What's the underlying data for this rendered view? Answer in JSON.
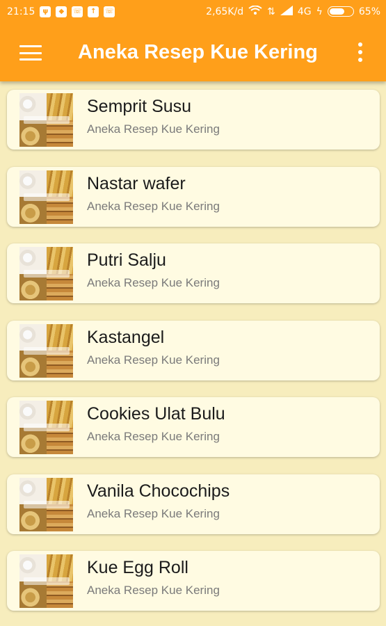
{
  "status_bar": {
    "time": "21:15",
    "notifications": [
      "usb-icon",
      "android-icon",
      "whatsapp-icon",
      "download-icon",
      "whatsapp-icon"
    ],
    "network_speed": "2,65K/d",
    "network_type": "4G",
    "battery": "65%",
    "battery_level": 0.65
  },
  "app_bar": {
    "title": "Aneka Resep Kue Kering",
    "menu_icon": "hamburger-menu-icon",
    "overflow_icon": "more-vertical-icon",
    "color": "#ff9f1a"
  },
  "recipes": [
    {
      "title": "Semprit Susu",
      "subtitle": "Aneka Resep Kue Kering"
    },
    {
      "title": "Nastar wafer",
      "subtitle": "Aneka Resep Kue Kering"
    },
    {
      "title": "Putri Salju",
      "subtitle": "Aneka Resep Kue Kering"
    },
    {
      "title": "Kastangel",
      "subtitle": "Aneka Resep Kue Kering"
    },
    {
      "title": "Cookies Ulat Bulu",
      "subtitle": "Aneka Resep Kue Kering"
    },
    {
      "title": "Vanila Chocochips",
      "subtitle": "Aneka Resep Kue Kering"
    },
    {
      "title": "Kue Egg Roll",
      "subtitle": "Aneka Resep Kue Kering"
    }
  ]
}
